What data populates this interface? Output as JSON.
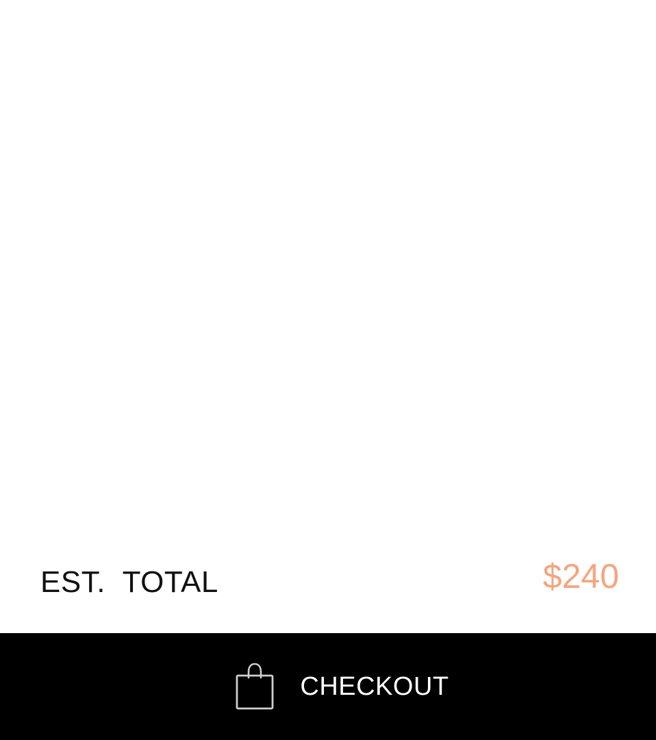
{
  "summary": {
    "total_label": "EST.  TOTAL",
    "total_value": "$240"
  },
  "checkout": {
    "label": "CHECKOUT",
    "icon": "shopping-bag-icon"
  },
  "colors": {
    "price_accent": "#F4A57F",
    "checkout_background": "#000000",
    "checkout_text": "#FFFFFF",
    "page_background": "#FFFFFF"
  }
}
